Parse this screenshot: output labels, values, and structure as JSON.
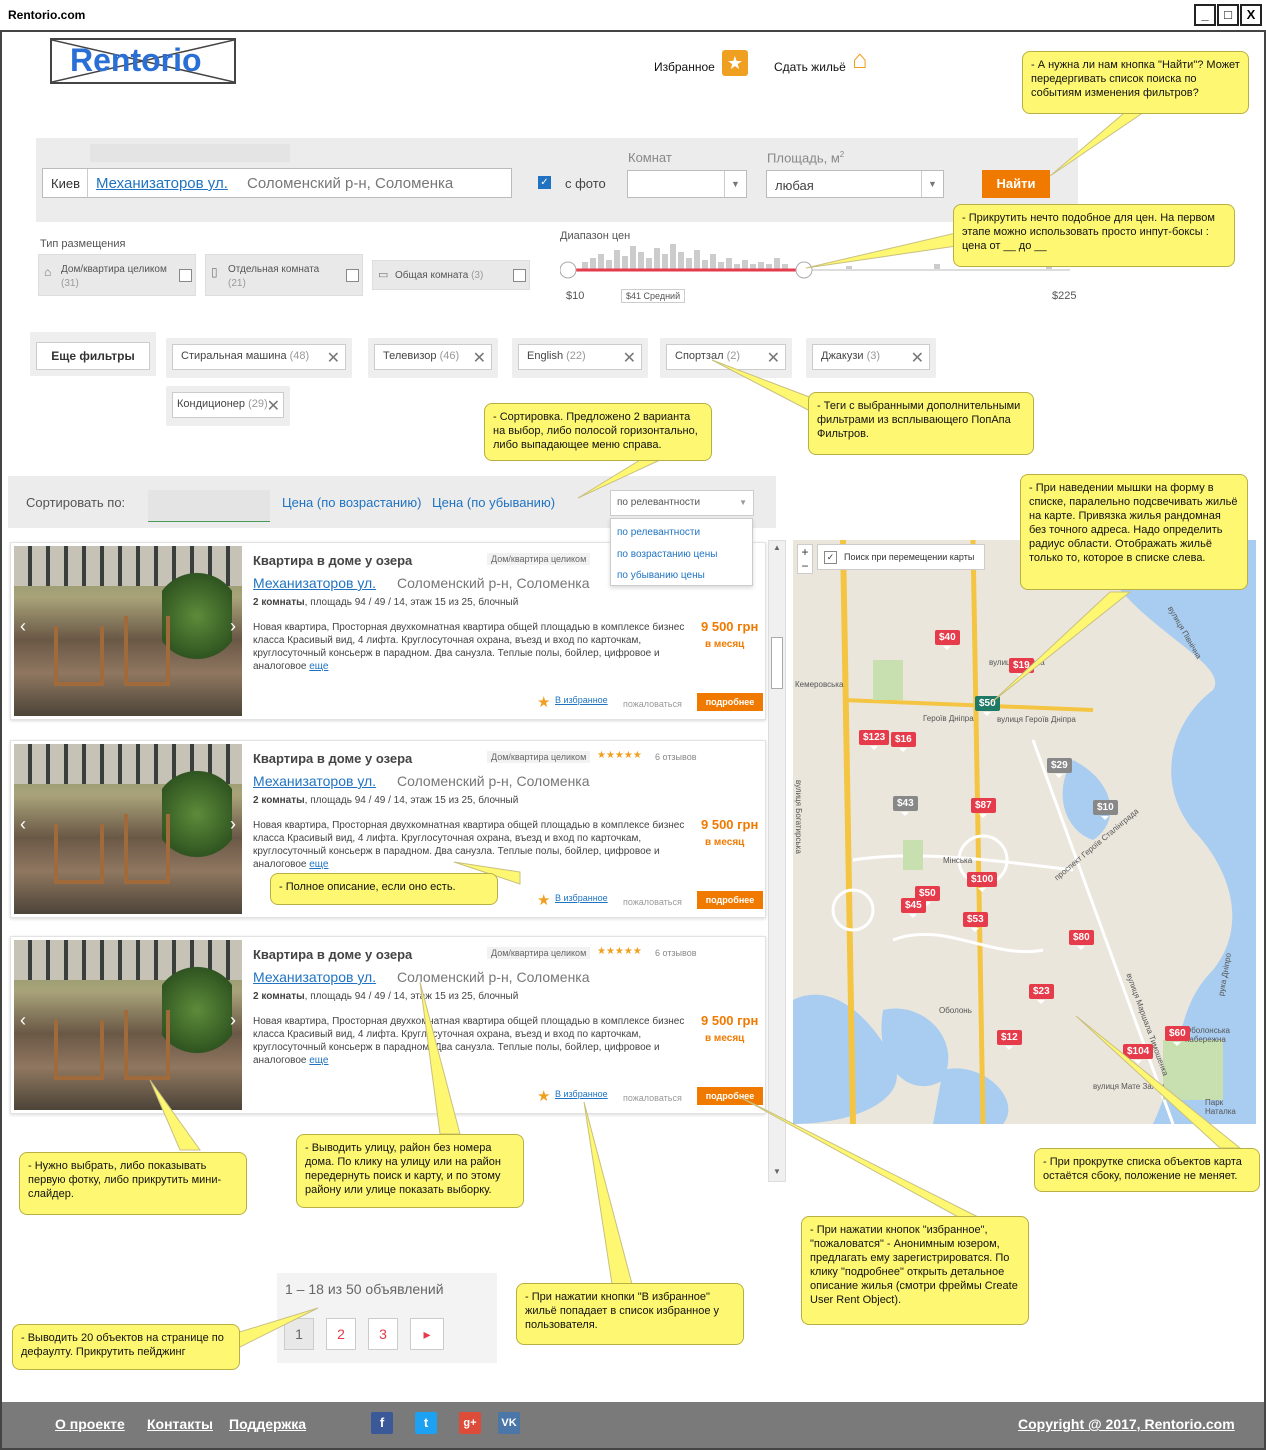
{
  "window": {
    "title": "Rentorio.com",
    "min": "_",
    "max": "□",
    "close": "X"
  },
  "header": {
    "logo": "Rentorio",
    "favorites": "Избранное",
    "rent_out": "Сдать жильё"
  },
  "search": {
    "city": "Киев",
    "street": "Механизаторов ул.",
    "district": "Соломенский р-н, Соломенка",
    "photo_label": "с фото",
    "rooms_label": "Комнат",
    "area_label": "Площадь, м",
    "area_sup": "2",
    "area_value": "любая",
    "find_button": "Найти"
  },
  "placement": {
    "label": "Тип размещения",
    "options": [
      {
        "label": "Дом/квартира целиком",
        "count": "(31)"
      },
      {
        "label": "Отдельная комната",
        "count": "(21)"
      },
      {
        "label": "Общая комната",
        "count": "(3)"
      }
    ]
  },
  "price_range": {
    "label": "Диапазон цен",
    "min": "$10",
    "max": "$225",
    "avg": "$41 Средний"
  },
  "filters": {
    "more_button": "Еще фильтры",
    "chips": [
      {
        "label": "Стиральная машина",
        "count": "(48)"
      },
      {
        "label": "Телевизор",
        "count": "(46)"
      },
      {
        "label": "English",
        "count": "(22)"
      },
      {
        "label": "Спортзал",
        "count": "(2)"
      },
      {
        "label": "Джакузи",
        "count": "(3)"
      },
      {
        "label": "Кондиционер",
        "count": "(29)"
      }
    ]
  },
  "sort": {
    "label": "Сортировать по:",
    "asc": "Цена (по возрастанию)",
    "desc": "Цена (по убыванию)",
    "selected": "по релевантности",
    "options": [
      "по релевантности",
      "по возрастанию цены",
      "по убыванию цены"
    ]
  },
  "listing": {
    "title": "Квартира в доме у озера",
    "type": "Дом/квартира целиком",
    "stars": "★★★★★",
    "reviews": "6 отзывов",
    "street": "Механизаторов ул.",
    "district": "Соломенский р-н, Соломенка",
    "rooms": "2 комнаты",
    "meta": ", площадь 94 / 49 / 14, этаж 15 из 25, блочный",
    "desc": "Новая квартира, Просторная двухкомнатная квартира общей площадью в комплексе бизнес класса Красивый вид, 4 лифта. Круглосуточная охрана, въезд и вход по карточкам, круглосуточный консьерж в парадном. Два санузла. Теплые полы, бойлер, цифровое и аналоговое",
    "more_link": "еще",
    "price": "9 500 грн",
    "per": "в месяц",
    "fav": "В избранное",
    "complain": "пожаловаться",
    "details": "подробнее"
  },
  "pagination": {
    "summary": "1 – 18 из 50 объявлений",
    "pages": [
      "1",
      "2",
      "3"
    ],
    "next": "▸"
  },
  "map": {
    "search_on_move": "Поиск при перемещении карты",
    "zoom_in": "+",
    "zoom_out": "−",
    "streets": [
      "вулиця Північна",
      "вулиця Озерна",
      "Кемеровська",
      "Героїв Дніпра",
      "вулиця Героїв Дніпра",
      "Мінська",
      "вулиця Богатирська",
      "Оболонь",
      "проспект Героїв Сталінграда",
      "вулиця Маршала Тимошенка",
      "вулиця Мате Залки",
      "рука Дніпро",
      "Оболонська набережна",
      "Парк Наталка"
    ],
    "pins": [
      {
        "label": "$40",
        "style": "red"
      },
      {
        "label": "$19",
        "style": "red"
      },
      {
        "label": "$50",
        "style": "green"
      },
      {
        "label": "$123",
        "style": "red"
      },
      {
        "label": "$16",
        "style": "red"
      },
      {
        "label": "$29",
        "style": "gray"
      },
      {
        "label": "$43",
        "style": "gray"
      },
      {
        "label": "$87",
        "style": "red"
      },
      {
        "label": "$10",
        "style": "gray"
      },
      {
        "label": "$100",
        "style": "red"
      },
      {
        "label": "$50",
        "style": "red"
      },
      {
        "label": "$45",
        "style": "red"
      },
      {
        "label": "$53",
        "style": "red"
      },
      {
        "label": "$80",
        "style": "red"
      },
      {
        "label": "$23",
        "style": "red"
      },
      {
        "label": "$12",
        "style": "red"
      },
      {
        "label": "$104",
        "style": "red"
      },
      {
        "label": "$60",
        "style": "red"
      }
    ]
  },
  "notes": {
    "find": "- А нужна ли нам кнопка \"Найти\"? Может передергивать список поиска по событиям изменения фильтров?",
    "price": "- Прикрутить нечто подобное для цен. На первом этапе можно использовать просто инпут-боксы : цена от __ до __",
    "filters": "- Теги с выбранными дополнительными фильтрами из всплывающего ПопАпа Фильтров.",
    "sort": "- Сортировка. Предложено 2 варианта на выбор, либо полосой горизонтально, либо выпадающее меню справа.",
    "hover": "- При наведении мышки на форму в списке, паралельно подсвечивать жильё на карте. Привязка жилья рандомная без точного адреса. Надо определить радиус области. Отображать жильё только то, которое в списке слева.",
    "desc": "- Полное описание, если оно есть.",
    "photo": "- Нужно выбрать, либо показывать первую фотку, либо прикрутить мини-слайдер.",
    "street": "- Выводить улицу, район без номера дома. По клику на улицу или на район передернуть поиск и карту, и по этому району или улице показать выборку.",
    "scroll": "- При прокрутке списка объектов  карта остаётся сбоку, положение не меняет.",
    "buttons": "- При нажатии кнопок \"избранное\", \"пожаловатся\" - Анонимным юзером, предлагать ему зарегистрироватся. По клику \"подробнее\" открыть детальное описание жилья (смотри фреймы Create User Rent Object).",
    "fav": "- При нажатии кнопки \"В избранное\" жильё попадает в список избранное у пользователя.",
    "paging": "- Выводить 20 объектов на странице по дефаулту. Прикрутить пейджинг"
  },
  "footer": {
    "about": "О проекте",
    "contacts": "Контакты",
    "support": "Поддержка",
    "copyright": "Copyright @ 2017, Rentorio.com",
    "social": [
      "f",
      "t",
      "g+",
      "VK"
    ]
  },
  "colors": {
    "accent": "#f07a00",
    "link": "#1f73c2",
    "pin": "#e53b4b",
    "note": "#fdf772",
    "footer": "#7a7a7a"
  }
}
